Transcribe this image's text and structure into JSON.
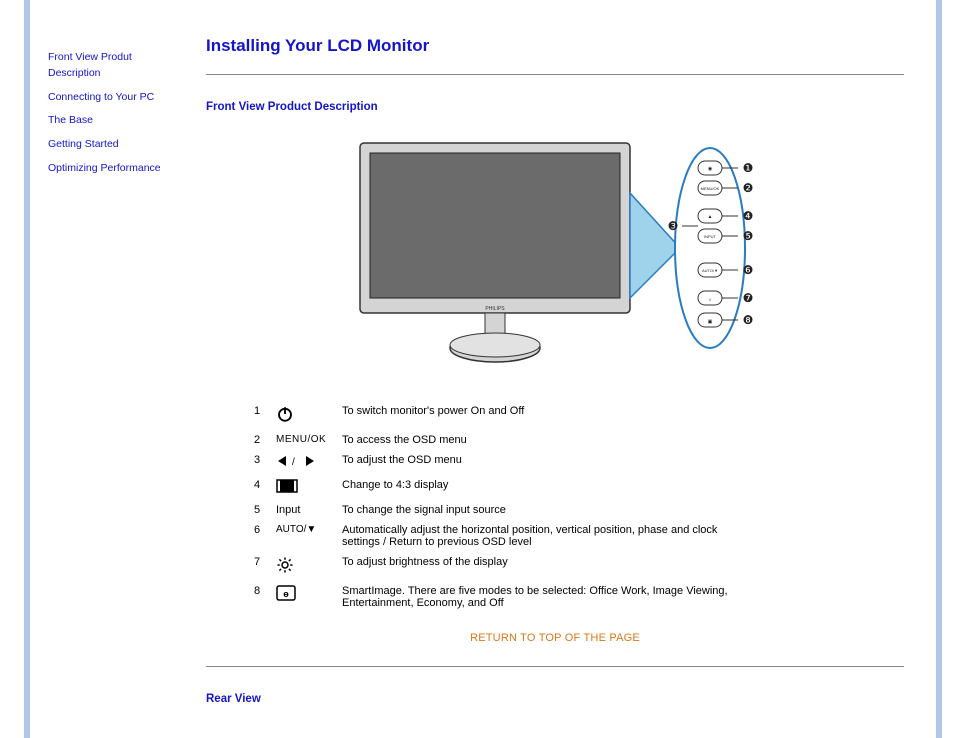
{
  "sidebar": {
    "items": [
      {
        "label": "Front View Produt Description"
      },
      {
        "label": "Connecting to Your PC"
      },
      {
        "label": "The Base"
      },
      {
        "label": "Getting Started"
      },
      {
        "label": "Optimizing Performance"
      }
    ]
  },
  "main": {
    "title": "Installing Your LCD Monitor",
    "section1_heading": "Front View Product Description",
    "return_link": "RETURN TO TOP OF THE PAGE",
    "section2_heading": "Rear View",
    "monitor_brand": "PHILIPS"
  },
  "legend": {
    "rows": [
      {
        "num": "1",
        "icon": "power-icon",
        "icon_text": "",
        "desc": "To switch monitor's power On and Off"
      },
      {
        "num": "2",
        "icon": "menu-ok-icon",
        "icon_text": "MENU/OK",
        "desc": "To access the OSD menu"
      },
      {
        "num": "3",
        "icon": "left-right-icon",
        "icon_text": "",
        "desc": "To adjust the OSD menu"
      },
      {
        "num": "4",
        "icon": "ratio-icon",
        "icon_text": "",
        "desc": "Change to 4:3 display"
      },
      {
        "num": "5",
        "icon": "input-icon",
        "icon_text": "Input",
        "desc": "To change the signal input source"
      },
      {
        "num": "6",
        "icon": "auto-down-icon",
        "icon_text": "AUTO/▼",
        "desc": "Automatically adjust the horizontal position, vertical position, phase and clock settings / Return to previous OSD level"
      },
      {
        "num": "7",
        "icon": "brightness-icon",
        "icon_text": "",
        "desc": "To adjust brightness of the display"
      },
      {
        "num": "8",
        "icon": "smartimage-icon",
        "icon_text": "",
        "desc": "SmartImage. There are five modes to be selected: Office Work, Image Viewing, Entertainment, Economy, and Off"
      }
    ]
  },
  "callouts": {
    "labels": [
      "❶",
      "❷",
      "❸",
      "❹",
      "❺",
      "❻",
      "❼",
      "❽"
    ],
    "button_text": [
      "◉",
      "MENU/OK",
      "◀",
      "▲☼",
      "INPUT",
      "AUTO/▼",
      "☼",
      "▣"
    ]
  }
}
